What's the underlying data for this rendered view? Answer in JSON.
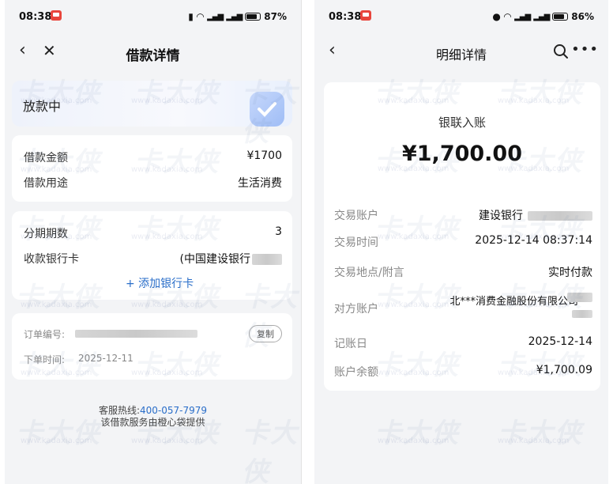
{
  "left": {
    "status": {
      "time": "08:38",
      "battery": "87%",
      "battery_level": 0.87
    },
    "nav": {
      "back_icon": "chevron-left-icon",
      "close_icon": "close-icon",
      "title": "借款详情"
    },
    "status_card": {
      "text": "放款中"
    },
    "loan": {
      "amount_label": "借款金额",
      "amount_value": "¥1700",
      "purpose_label": "借款用途",
      "purpose_value": "生活消费"
    },
    "installment": {
      "periods_label": "分期期数",
      "periods_value": "3",
      "bank_label": "收款银行卡",
      "bank_value": "(中国建设银行",
      "add_bank": "+ 添加银行卡"
    },
    "order": {
      "number_label": "订单编号:",
      "copy": "复制",
      "time_label": "下单时间:",
      "time_value": "2025-12-11"
    },
    "footer": {
      "hotline_label": "客服热线:",
      "hotline": "400-057-7979",
      "provider": "该借款服务由橙心袋提供"
    }
  },
  "right": {
    "status": {
      "time": "08:38",
      "battery": "86%",
      "battery_level": 0.86
    },
    "nav": {
      "back_icon": "chevron-left-icon",
      "title": "明细详情",
      "search_icon": "search-icon",
      "more_icon": "more-icon"
    },
    "detail": {
      "type": "银联入账",
      "amount": "¥1,700.00",
      "rows": [
        {
          "label": "交易账户",
          "value": "建设银行"
        },
        {
          "label": "交易时间",
          "value": "2025-12-14 08:37:14"
        },
        {
          "label": "交易地点/附言",
          "value": "实时付款"
        },
        {
          "label": "对方账户",
          "value": "北***消费金融股份有限公司 "
        },
        {
          "label": "记账日",
          "value": "2025-12-14"
        },
        {
          "label": "账户余额",
          "value": "¥1,700.09"
        }
      ]
    }
  },
  "watermark": {
    "text": "卡大侠",
    "url": "www.kadaxia.com"
  },
  "colors": {
    "accent": "#2a6ec9",
    "notification": "#e8453c",
    "background": "#f3f4f6"
  }
}
